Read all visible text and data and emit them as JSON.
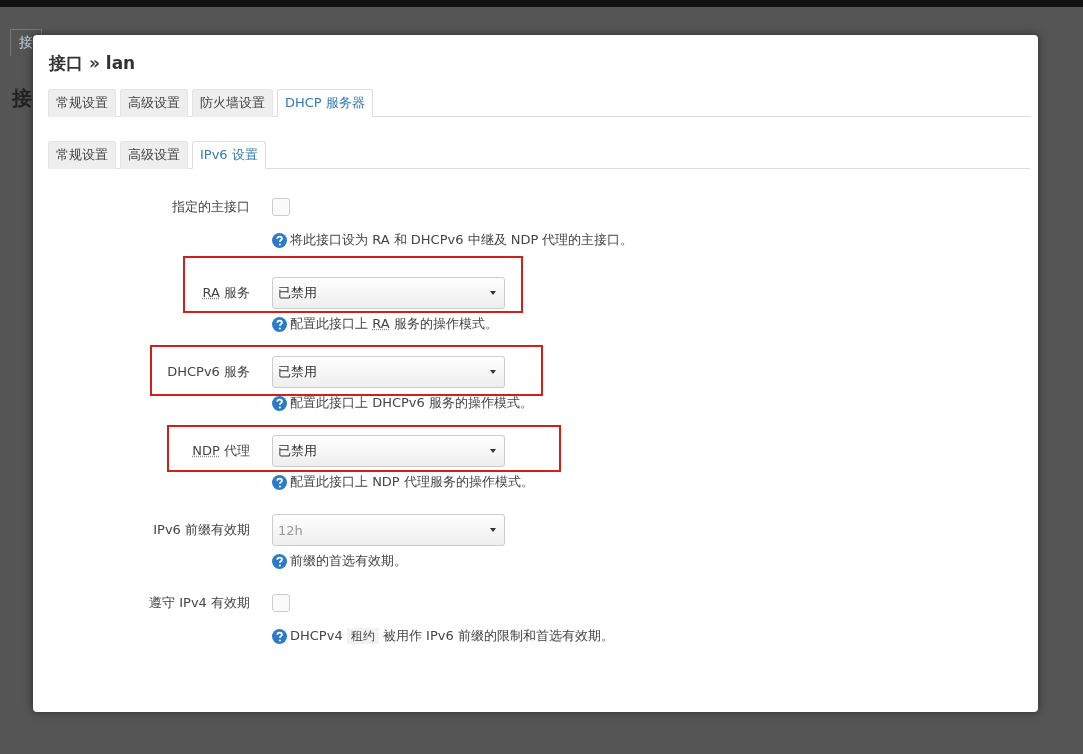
{
  "background": {
    "tab": "接",
    "heading": "接"
  },
  "dialog": {
    "title": "接口 » lan",
    "tabs": [
      {
        "label": "常规设置",
        "selected": false
      },
      {
        "label": "高级设置",
        "selected": false
      },
      {
        "label": "防火墙设置",
        "selected": false
      },
      {
        "label": "DHCP 服务器",
        "selected": true
      }
    ],
    "subtabs": [
      {
        "label": "常规设置",
        "selected": false
      },
      {
        "label": "高级设置",
        "selected": false
      },
      {
        "label": "IPv6 设置",
        "selected": true
      }
    ],
    "fields": [
      {
        "kind": "checkbox",
        "label": [
          {
            "text": "指定的主接口",
            "kind": "plain"
          }
        ],
        "checked": false,
        "highlighted": false,
        "hint": [
          {
            "text": "将此接口设为 RA 和 DHCPv6 中继及 NDP 代理的主接口。",
            "kind": "plain"
          }
        ]
      },
      {
        "kind": "select",
        "label": [
          {
            "text": "RA",
            "kind": "abbr"
          },
          {
            "text": " 服务",
            "kind": "plain"
          }
        ],
        "value": "已禁用",
        "disabled": false,
        "highlighted": true,
        "hint": [
          {
            "text": "配置此接口上 ",
            "kind": "plain"
          },
          {
            "text": "RA",
            "kind": "abbr"
          },
          {
            "text": " 服务的操作模式。",
            "kind": "plain"
          }
        ]
      },
      {
        "kind": "select",
        "label": [
          {
            "text": "DHCPv6 服务",
            "kind": "plain"
          }
        ],
        "value": "已禁用",
        "disabled": false,
        "highlighted": true,
        "hint": [
          {
            "text": "配置此接口上 DHCPv6 服务的操作模式。",
            "kind": "plain"
          }
        ]
      },
      {
        "kind": "select",
        "label": [
          {
            "text": "NDP",
            "kind": "abbr"
          },
          {
            "text": " 代理",
            "kind": "plain"
          }
        ],
        "value": "已禁用",
        "disabled": false,
        "highlighted": true,
        "hint": [
          {
            "text": "配置此接口上 NDP 代理服务的操作模式。",
            "kind": "plain"
          }
        ]
      },
      {
        "kind": "select",
        "label": [
          {
            "text": "IPv6 前缀有效期",
            "kind": "plain"
          }
        ],
        "value": "12h",
        "disabled": true,
        "highlighted": false,
        "hint": [
          {
            "text": "前缀的首选有效期。",
            "kind": "plain"
          }
        ]
      },
      {
        "kind": "checkbox",
        "label": [
          {
            "text": "遵守 IPv4 有效期",
            "kind": "plain"
          }
        ],
        "checked": false,
        "highlighted": false,
        "hint": [
          {
            "text": "DHCPv4 ",
            "kind": "plain"
          },
          {
            "text": "租约",
            "kind": "code"
          },
          {
            "text": " 被用作 IPv6 前缀的限制和首选有效期。",
            "kind": "plain"
          }
        ]
      }
    ]
  }
}
